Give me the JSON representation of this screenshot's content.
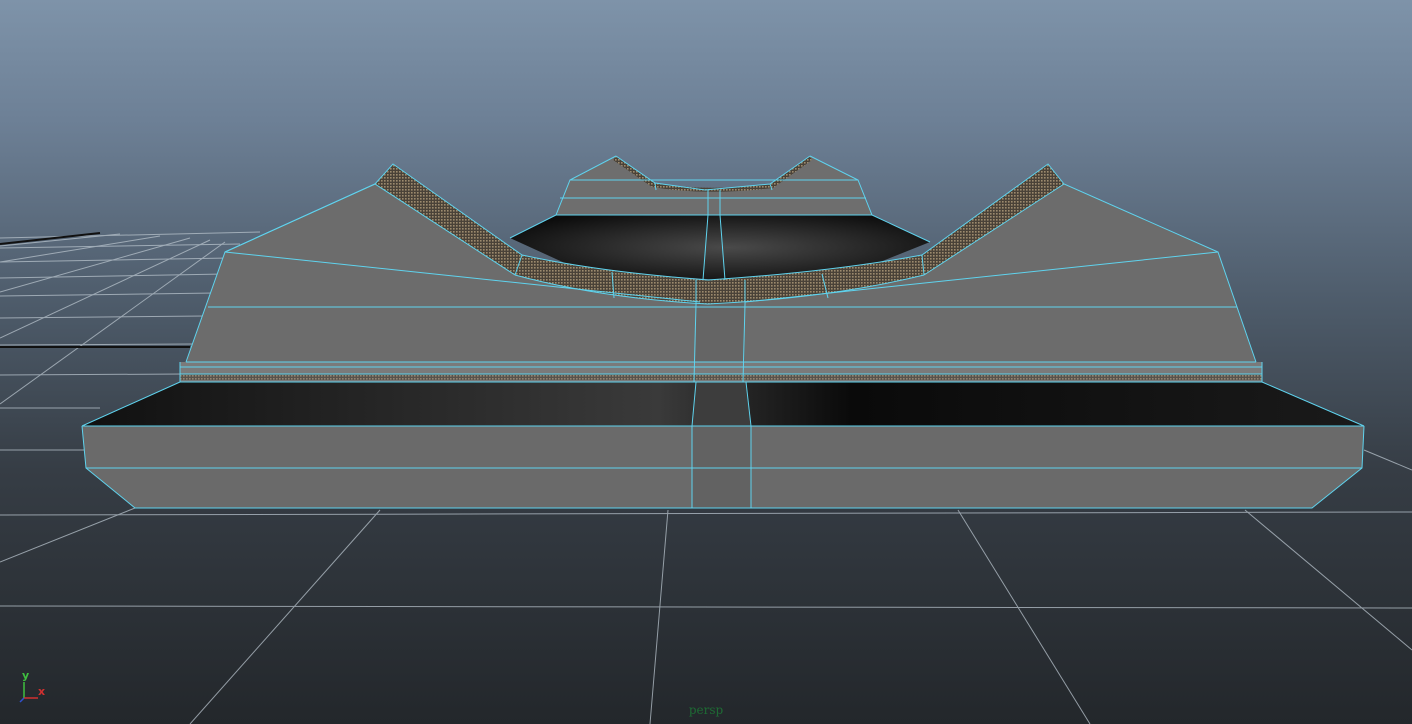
{
  "viewport": {
    "camera_name": "persp",
    "panel_type": "perspective-viewport",
    "wireframe_on_shaded": true,
    "grid": true
  },
  "axis_gizmo": {
    "y_label": "y",
    "x_label": "x"
  },
  "colors": {
    "background_top": "#7e93a9",
    "background_bottom": "#23272b",
    "wireframe": "#5fd3ee",
    "grid_line": "#b8c3cc",
    "mesh_face": "#6a6a6a",
    "mesh_dark": "#101010",
    "bevel_texture": "#8a7860",
    "axis_x": "#d03030",
    "axis_y": "#3fbf3f",
    "camera_label": "#1e6b34"
  }
}
